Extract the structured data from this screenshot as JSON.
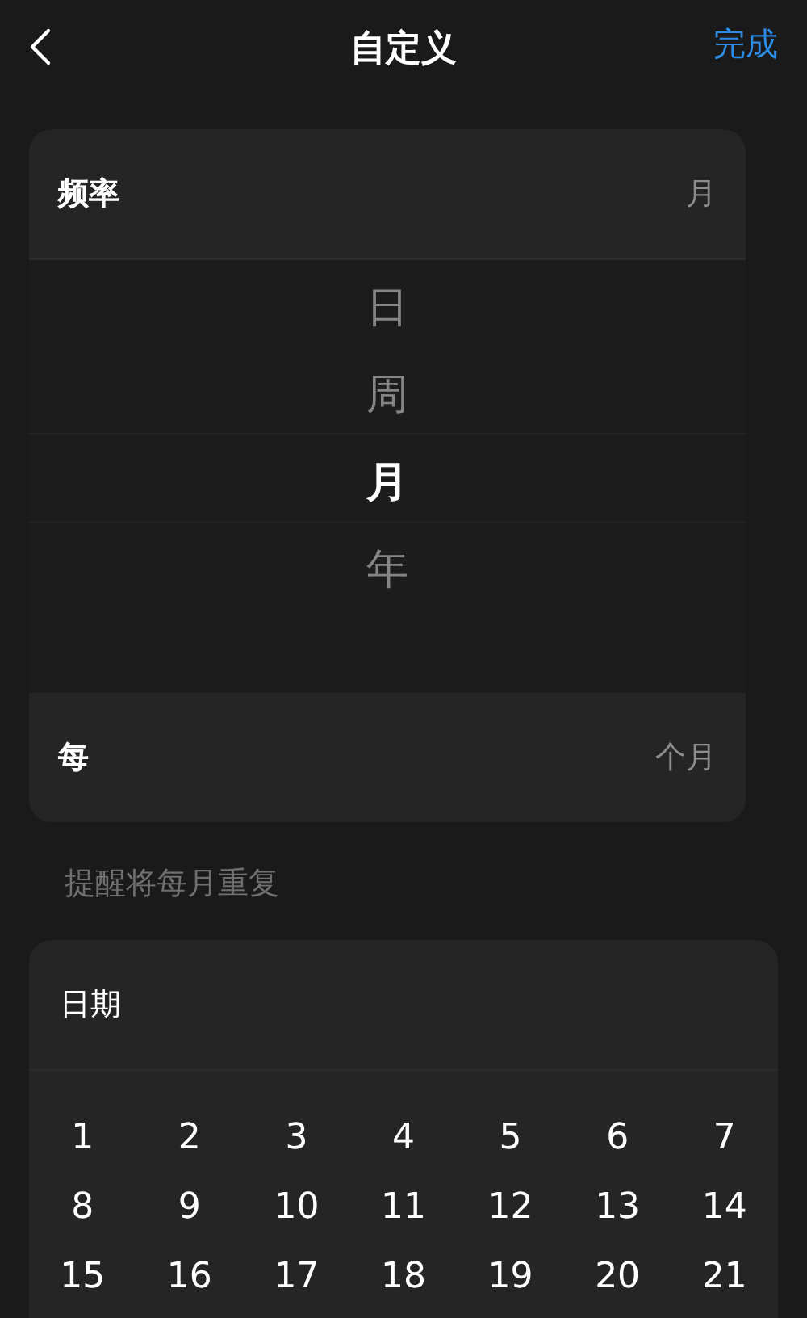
{
  "nav": {
    "title": "自定义",
    "done": "完成"
  },
  "frequency_card": {
    "label": "频率",
    "value": "月",
    "picker": [
      {
        "label": "日",
        "selected": false
      },
      {
        "label": "周",
        "selected": false
      },
      {
        "label": "月",
        "selected": true
      },
      {
        "label": "年",
        "selected": false
      }
    ],
    "every_label": "每",
    "every_value": "个月"
  },
  "hint": "提醒将每月重复",
  "date_card": {
    "title": "日期",
    "days": [
      "1",
      "2",
      "3",
      "4",
      "5",
      "6",
      "7",
      "8",
      "9",
      "10",
      "11",
      "12",
      "13",
      "14",
      "15",
      "16",
      "17",
      "18",
      "19",
      "20",
      "21"
    ]
  }
}
